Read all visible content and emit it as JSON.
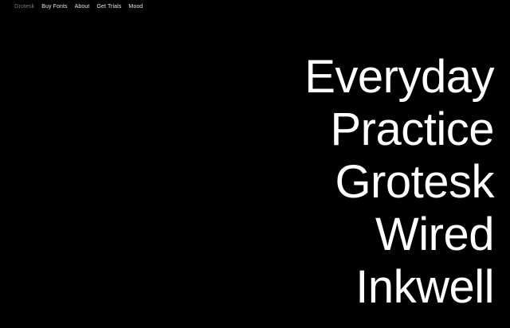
{
  "nav": {
    "items": [
      {
        "label": "Grotesk",
        "active": true
      },
      {
        "label": "Buy Fonts",
        "active": false
      },
      {
        "label": "About",
        "active": false
      },
      {
        "label": "Get Trials",
        "active": false
      },
      {
        "label": "Mood",
        "active": false
      }
    ]
  },
  "fonts": {
    "items": [
      {
        "label": "Everyday"
      },
      {
        "label": "Practice"
      },
      {
        "label": "Grotesk"
      },
      {
        "label": "Wired"
      },
      {
        "label": "Inkwell"
      }
    ]
  },
  "colors": {
    "background": "#000000",
    "text": "#ffffff",
    "nav_active": "#7a7a7a"
  }
}
